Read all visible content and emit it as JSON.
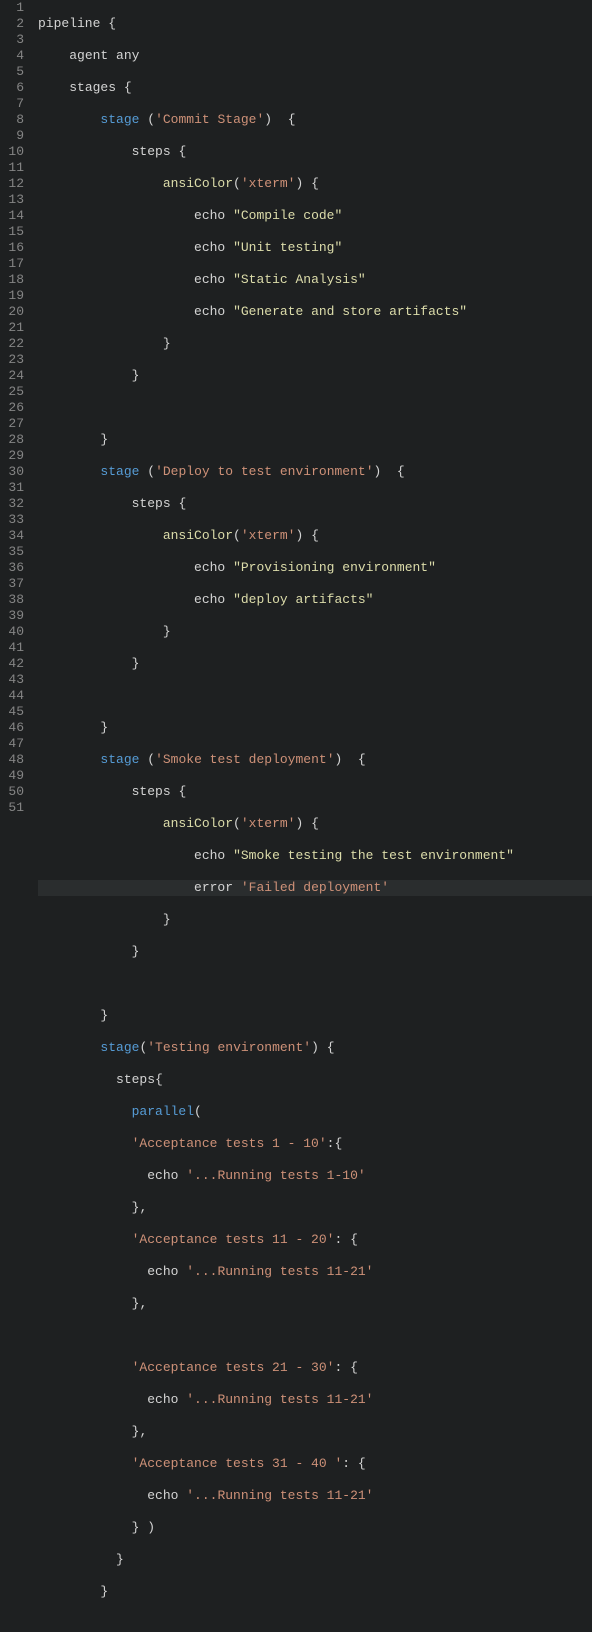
{
  "lineCount": 51,
  "highlightedLine": 28,
  "tokens": {
    "pipeline": "pipeline",
    "agent": "agent",
    "any": "any",
    "stages": "stages",
    "stage": "stage",
    "steps": "steps",
    "ansiColor": "ansiColor",
    "echo": "echo",
    "error": "error",
    "parallel": "parallel"
  },
  "strings": {
    "commit_stage": "'Commit Stage'",
    "xterm": "'xterm'",
    "compile": "\"Compile code\"",
    "unit": "\"Unit testing\"",
    "static": "\"Static Analysis\"",
    "generate": "\"Generate and store artifacts\"",
    "deploy_test": "'Deploy to test environment'",
    "provisioning": "\"Provisioning environment\"",
    "deploy_art": "\"deploy artifacts\"",
    "smoke_test": "'Smoke test deployment'",
    "smoke_testing": "\"Smoke testing the test environment\"",
    "failed": "'Failed deployment'",
    "testing_env": "'Testing environment'",
    "acc1": "'Acceptance tests 1 - 10'",
    "run1": "'...Running tests 1-10'",
    "acc2": "'Acceptance tests 11 - 20'",
    "run2": "'...Running tests 11-21'",
    "acc3": "'Acceptance tests 21 - 30'",
    "run3": "'...Running tests 11-21'",
    "acc4": "'Acceptance tests 31 - 40 '",
    "run4": "'...Running tests 11-21'"
  },
  "punct": {
    "lbrace": "{",
    "rbrace": "}",
    "lparen": "(",
    "rparen": ")",
    "colon": ":",
    "comma": ",",
    "rbrace_rparen": "} )"
  }
}
